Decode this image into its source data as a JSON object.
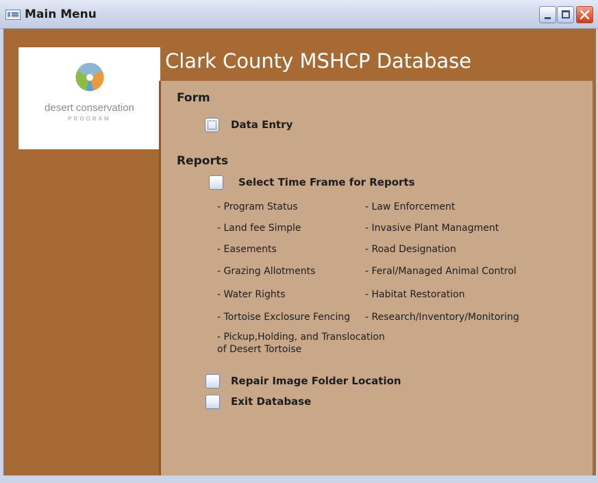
{
  "window": {
    "title": "Main Menu",
    "controls": {
      "minimize": "minimize",
      "maximize": "maximize",
      "close": "close"
    }
  },
  "logo": {
    "line1": "desert conservation",
    "line2": "PROGRAM",
    "colors": {
      "top": "#8fb4cf",
      "left": "#8dbb4a",
      "right": "#e89a3c",
      "bottom": "#5fa0c4"
    }
  },
  "app": {
    "title": "Clark County MSHCP Database"
  },
  "form": {
    "heading": "Form",
    "data_entry_label": "Data Entry"
  },
  "reports": {
    "heading": "Reports",
    "select_time_frame_label": "Select Time Frame for Reports",
    "left_items": [
      "- Program Status",
      "- Land fee Simple",
      "- Easements",
      "- Grazing Allotments",
      "- Water Rights",
      "- Tortoise Exclosure Fencing",
      "- Pickup,Holding, and Translocation of Desert Tortoise"
    ],
    "right_items": [
      "- Law Enforcement",
      "- Invasive Plant Managment",
      "- Road Designation",
      "- Feral/Managed Animal Control",
      "- Habitat Restoration",
      "- Research/Inventory/Monitoring"
    ]
  },
  "actions": {
    "repair_label": "Repair Image Folder Location",
    "exit_label": "Exit Database"
  },
  "theme": {
    "frame_brown": "#a86a35",
    "panel_tan": "#c9a88a",
    "title_bar": "#d2daec"
  }
}
